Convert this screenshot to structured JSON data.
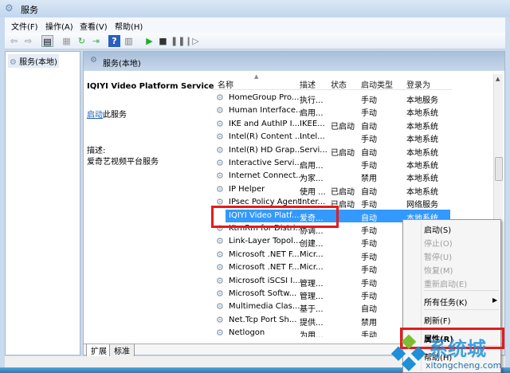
{
  "window": {
    "title": "服务"
  },
  "menu": [
    "文件(F)",
    "操作(A)",
    "查看(V)",
    "帮助(H)"
  ],
  "tree": {
    "item": "服务(本地)"
  },
  "panel": {
    "header": "服务(本地)",
    "service_name": "IQIYI Video Platform Service",
    "start_link": "启动",
    "start_suffix": "此服务",
    "desc_label": "描述:",
    "desc_text": "爱奇艺视频平台服务"
  },
  "columns": [
    "名称",
    "描述",
    "状态",
    "启动类型",
    "登录为"
  ],
  "rows": [
    [
      "HomeGroup Pro...",
      "执行...",
      "",
      "手动",
      "本地服务"
    ],
    [
      "Human Interface...",
      "启用...",
      "",
      "手动",
      "本地系统"
    ],
    [
      "IKE and AuthIP I...",
      "IKEE...",
      "已启动",
      "自动",
      "本地系统"
    ],
    [
      "Intel(R) Content ...",
      "Intel...",
      "",
      "手动",
      "本地系统"
    ],
    [
      "Intel(R) HD Grap...",
      "Servi...",
      "已启动",
      "自动",
      "本地系统"
    ],
    [
      "Interactive Servi...",
      "启用...",
      "",
      "手动",
      "本地系统"
    ],
    [
      "Internet Connect...",
      "为家...",
      "",
      "禁用",
      "本地系统"
    ],
    [
      "IP Helper",
      "使用 ...",
      "已启动",
      "自动",
      "本地系统"
    ],
    [
      "IPsec Policy Agent",
      "Inter...",
      "已启动",
      "手动",
      "网络服务"
    ],
    [
      "IQIYI Video Platf...",
      "爱奇...",
      "",
      "自动",
      "本地系统"
    ],
    [
      "KtmRm for Distri...",
      "协调...",
      "",
      "手动",
      ""
    ],
    [
      "Link-Layer Topol...",
      "创建...",
      "",
      "手动",
      ""
    ],
    [
      "Microsoft .NET F...",
      "Micr...",
      "",
      "手动",
      ""
    ],
    [
      "Microsoft .NET F...",
      "Micr...",
      "",
      "手动",
      ""
    ],
    [
      "Microsoft iSCSI I...",
      "管理...",
      "",
      "手动",
      ""
    ],
    [
      "Microsoft Softw...",
      "管理...",
      "",
      "手动",
      ""
    ],
    [
      "Multimedia Clas...",
      "基于...",
      "",
      "自动",
      ""
    ],
    [
      "Net.Tcp Port Sh...",
      "提供...",
      "",
      "禁用",
      ""
    ],
    [
      "Netlogon",
      "为用...",
      "",
      "手动",
      ""
    ]
  ],
  "tabs": [
    "扩展",
    "标准"
  ],
  "context_menu": {
    "start": "启动(S)",
    "stop": "停止(O)",
    "pause": "暂停(U)",
    "resume": "恢复(M)",
    "restart": "重新启动(E)",
    "all_tasks": "所有任务(K)",
    "refresh": "刷新(F)",
    "properties": "属性(R)",
    "help": "帮助(H)"
  },
  "watermark": {
    "brand": "系统城",
    "url": "xitongcheng.com"
  }
}
